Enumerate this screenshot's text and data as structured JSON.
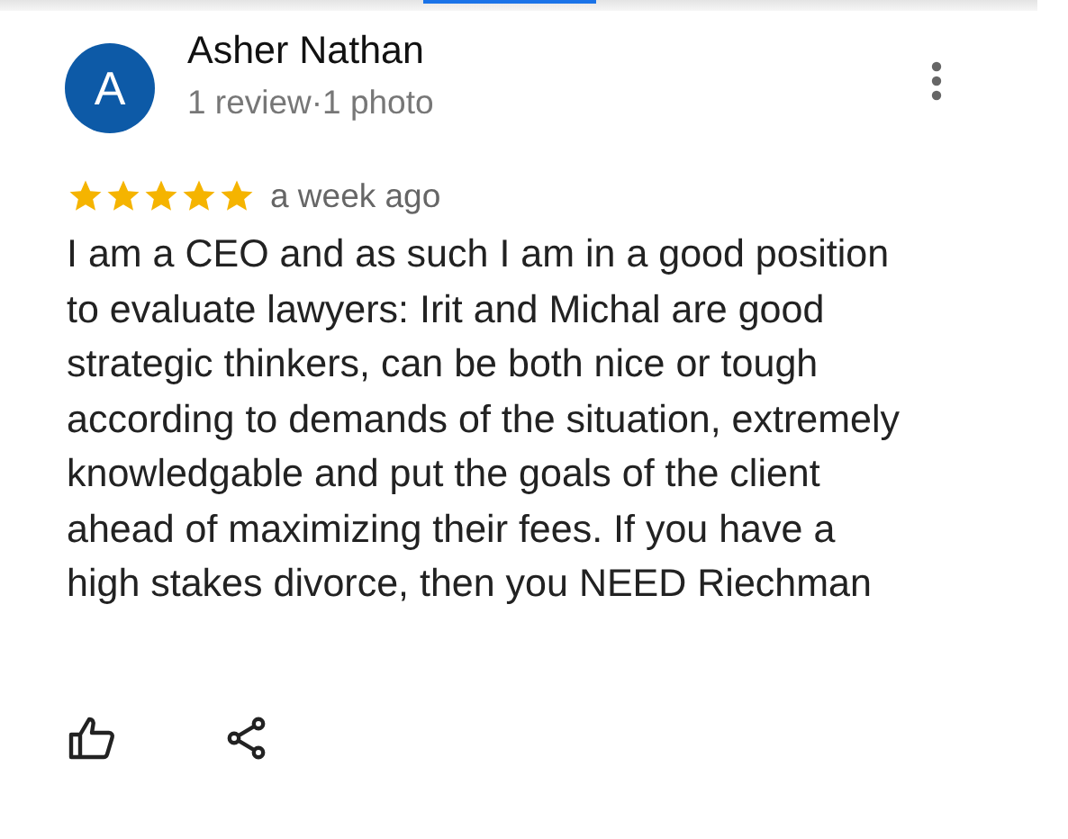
{
  "review": {
    "avatar_letter": "A",
    "author": "Asher Nathan",
    "meta": "1 review·1 photo",
    "stars": 5,
    "time": "a week ago",
    "text": "I am a CEO and as such I am in a good position to evaluate lawyers: Irit and Michal are good strategic thinkers, can be both nice or tough according to demands of the situation, extremely knowledgable and put the goals of the client ahead of maximizing their fees. If you have a high stakes divorce, then you NEED Riechman"
  }
}
